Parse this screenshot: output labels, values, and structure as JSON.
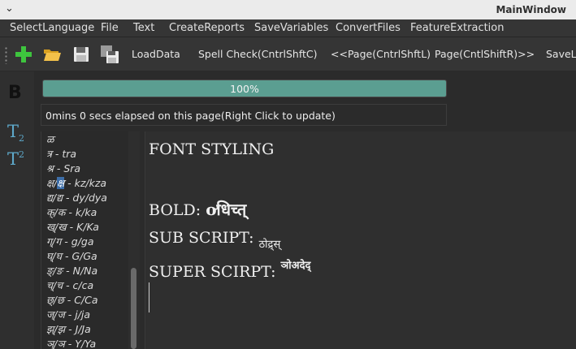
{
  "window": {
    "title": "MainWindow",
    "menu_arrow": "⌄"
  },
  "menu": [
    "SelectLanguage",
    "File",
    "Text",
    "CreateReports",
    "SaveVariables",
    "ConvertFiles",
    "FeatureExtraction"
  ],
  "toolbar": {
    "icons": [
      "add-icon",
      "open-folder-icon",
      "save-icon",
      "save-all-icon"
    ],
    "buttons": [
      "LoadData",
      "Spell Check(CntrlShftC)",
      "<<Page(CntrlShftL)",
      "Page(CntlShiftR)>>",
      "SaveLo"
    ]
  },
  "leftbar": {
    "bold": "B",
    "sub_base": "T",
    "sub_mark": "2",
    "sup_base": "T",
    "sup_mark": "2"
  },
  "progress": {
    "value": 100,
    "text": "100%"
  },
  "elapsed": "0mins 0 secs elapsed on this page(Right Click to update)",
  "charlist": [
    {
      "char": "ळ",
      "roman": ""
    },
    {
      "char": "त्र",
      "roman": " - tra"
    },
    {
      "char": "श्र",
      "roman": "  - Sra"
    },
    {
      "char": "क्ष/",
      "sel": "क्ष",
      "roman": "  - kz/kza"
    },
    {
      "char": "द्य/द्य",
      "roman": "  - dy/dya"
    },
    {
      "char": "क्/क",
      "roman": "  - k/ka"
    },
    {
      "char": "ख्/ख",
      "roman": "   - K/Ka"
    },
    {
      "char": "ग्/ग",
      "roman": "  - g/ga"
    },
    {
      "char": "घ्/घ",
      "roman": "  - G/Ga"
    },
    {
      "char": "ङ्/ङ",
      "roman": "  - N/Na"
    },
    {
      "char": "च्/च",
      "roman": "  - c/ca"
    },
    {
      "char": "छ्/छ",
      "roman": "  - C/Ca"
    },
    {
      "char": "ज्/ज",
      "roman": "  - j/ja"
    },
    {
      "char": "झ्/झ",
      "roman": "  - J/Ja"
    },
    {
      "char": "ञ्/ञ",
      "roman": "  - Y/Ya"
    }
  ],
  "editor": {
    "line1": "FONT STYLING",
    "bold_label": "BOLD: ",
    "bold_text": "ơधिच्त्",
    "sub_label": "SUB SCRIPT: ",
    "sub_text": "ठोद्र्स्",
    "sup_label": "SUPER SCIRPT: ",
    "sup_text": "ञोअदेद्"
  },
  "colors": {
    "accent": "#5b9e91",
    "subsup_icon": "#5ea8c9",
    "selection": "#3d6ea8"
  }
}
